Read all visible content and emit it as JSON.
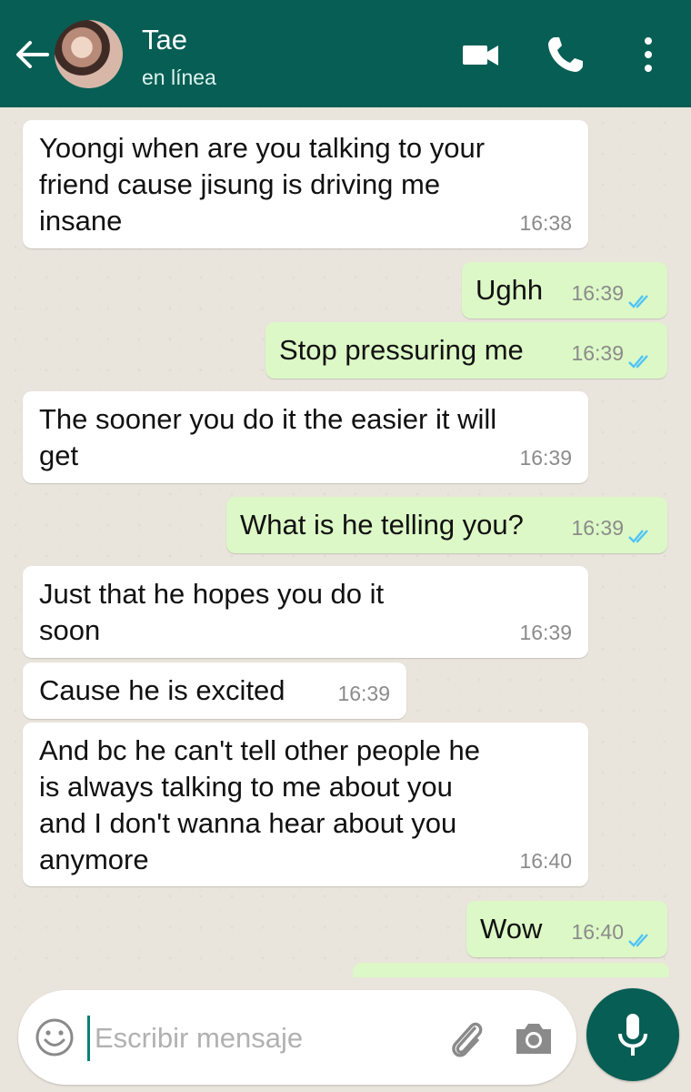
{
  "header": {
    "contact_name": "Tae",
    "status": "en línea",
    "icons": [
      "back-arrow-icon",
      "avatar-photo",
      "video-call-icon",
      "phone-icon",
      "more-options-icon"
    ],
    "color": "#075e54"
  },
  "messages": [
    {
      "dir": "in",
      "text": "Yoongi when are you talking to your\nfriend cause jisung is driving me\ninsane",
      "time": "16:38"
    },
    {
      "dir": "out",
      "text": "Ughh",
      "time": "16:39",
      "read": true
    },
    {
      "dir": "out",
      "text": "Stop pressuring me",
      "time": "16:39",
      "read": true
    },
    {
      "dir": "in",
      "text": "The sooner you do it the easier it will\nget",
      "time": "16:39"
    },
    {
      "dir": "out",
      "text": "What is he telling you?",
      "time": "16:39",
      "read": true
    },
    {
      "dir": "in",
      "text": "Just that he hopes you do it\nsoon",
      "time": "16:39"
    },
    {
      "dir": "in",
      "text": "Cause he is excited",
      "time": "16:39"
    },
    {
      "dir": "in",
      "text": "And bc he can't tell other people he\nis always talking to me about you\nand I don't wanna hear about you\nanymore",
      "time": "16:40"
    },
    {
      "dir": "out",
      "text": "Wow",
      "time": "16:40",
      "read": true
    }
  ],
  "composer": {
    "placeholder": "Escribir mensaje",
    "value": "",
    "icons": [
      "emoji-icon",
      "attach-icon",
      "camera-icon",
      "mic-icon"
    ]
  },
  "colors": {
    "incoming_bubble": "#ffffff",
    "outgoing_bubble": "#dcf8c6",
    "read_ticks": "#4fc3f7",
    "chat_background": "#e9e4dc"
  }
}
